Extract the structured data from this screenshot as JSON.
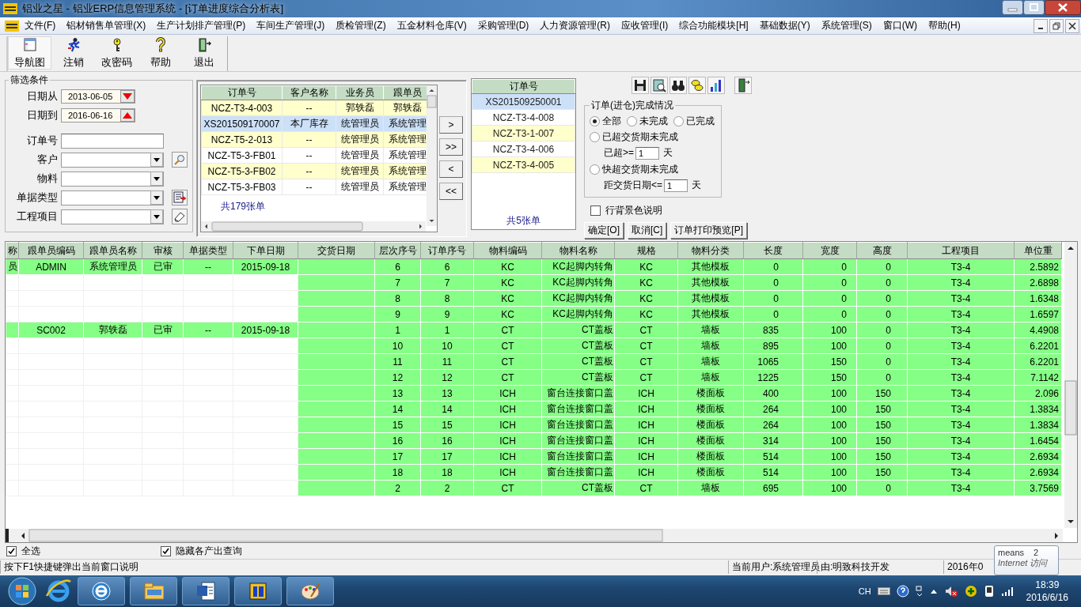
{
  "window": {
    "title": "铝业之星 - 铝业ERP信息管理系统 - [订单进度综合分析表]"
  },
  "menu": [
    "文件(F)",
    "铝材销售单管理(X)",
    "生产计划排产管理(P)",
    "车间生产管理(J)",
    "质检管理(Z)",
    "五金材料仓库(V)",
    "采购管理(D)",
    "人力资源管理(R)",
    "应收管理(I)",
    "综合功能模块[H]",
    "基础数据(Y)",
    "系统管理(S)",
    "窗口(W)",
    "帮助(H)"
  ],
  "toolbar": [
    {
      "label": "导航图",
      "selected": true
    },
    {
      "label": "注销",
      "selected": false
    },
    {
      "label": "改密码",
      "selected": false
    },
    {
      "label": "帮助",
      "selected": false
    },
    {
      "label": "退出",
      "selected": false
    }
  ],
  "filter": {
    "title": "筛选条件",
    "fields": [
      {
        "label": "日期从",
        "kind": "date",
        "value": "2013-06-05"
      },
      {
        "label": "日期到",
        "kind": "date",
        "value": "2016-06-16"
      },
      {
        "label": "订单号",
        "kind": "text"
      },
      {
        "label": "客户",
        "kind": "combo"
      },
      {
        "label": "物料",
        "kind": "combo"
      },
      {
        "label": "单据类型",
        "kind": "combo"
      },
      {
        "label": "工程项目",
        "kind": "combo"
      }
    ]
  },
  "orders": {
    "columns": [
      "订单号",
      "客户名称",
      "业务员",
      "跟单员"
    ],
    "rows": [
      {
        "cells": [
          "NCZ-T3-4-003",
          "--",
          "郭轶磊",
          "郭轶磊"
        ],
        "selected": false,
        "color": "#ffffcc"
      },
      {
        "cells": [
          "XS201509170007",
          "本厂库存",
          "统管理员",
          "系统管理"
        ],
        "selected": true
      },
      {
        "cells": [
          "NCZ-T5-2-013",
          "--",
          "统管理员",
          "系统管理"
        ],
        "selected": false,
        "color": "#ffffcc"
      },
      {
        "cells": [
          "NCZ-T5-3-FB01",
          "--",
          "统管理员",
          "系统管理"
        ],
        "selected": false,
        "color": "#ffffff"
      },
      {
        "cells": [
          "NCZ-T5-3-FB02",
          "--",
          "统管理员",
          "系统管理"
        ],
        "selected": false,
        "color": "#ffffcc"
      },
      {
        "cells": [
          "NCZ-T5-3-FB03",
          "--",
          "统管理员",
          "系统管理"
        ],
        "selected": false,
        "color": "#ffffff"
      }
    ],
    "count": "共179张单"
  },
  "transfer_buttons": [
    ">",
    ">>",
    "<",
    "<<"
  ],
  "picked": {
    "column": "订单号",
    "rows": [
      {
        "text": "XS201509250001",
        "selected": true
      },
      {
        "text": "NCZ-T3-4-008",
        "selected": false,
        "color": "#ffffff"
      },
      {
        "text": "NCZ-T3-1-007",
        "selected": false,
        "color": "#ffffcc"
      },
      {
        "text": "NCZ-T3-4-006",
        "selected": false,
        "color": "#ffffff"
      },
      {
        "text": "NCZ-T3-4-005",
        "selected": false,
        "color": "#ffffcc"
      }
    ],
    "count": "共5张单"
  },
  "completion": {
    "title": "订单(进仓)完成情况",
    "options": [
      {
        "label": "全部",
        "selected": true
      },
      {
        "label": "未完成",
        "selected": false
      },
      {
        "label": "已完成",
        "selected": false
      },
      {
        "label": "已超交货期未完成",
        "selected": false,
        "prefix": "已超>=",
        "value": "1",
        "unit": "天"
      },
      {
        "label": "快超交货期未完成",
        "selected": false,
        "prefix": "距交货日期<=",
        "value": "1",
        "unit": "天"
      }
    ]
  },
  "row_color_legend": {
    "label": "行背景色说明",
    "checked": false
  },
  "actions": [
    "确定[O]",
    "取消[C]",
    "订单打印预览[P]"
  ],
  "grid": {
    "columns": [
      "称",
      "跟单员编码",
      "跟单员名称",
      "审核",
      "单据类型",
      "下单日期",
      "交货日期",
      "层次序号",
      "订单序号",
      "物料编码",
      "物料名称",
      "规格",
      "物料分类",
      "长度",
      "宽度",
      "高度",
      "工程项目",
      "单位重"
    ],
    "rows": [
      {
        "kind": "group",
        "cells": [
          "员",
          "ADMIN",
          "系统管理员",
          "已审",
          "--",
          "2015-09-18",
          "",
          "6",
          "6",
          "KC",
          "KC起脚内转角",
          "KC",
          "其他模板",
          "0",
          "0",
          "0",
          "T3-4",
          "2.5892"
        ]
      },
      {
        "kind": "detail",
        "cells": [
          "",
          "",
          "",
          "",
          "",
          "",
          "",
          "7",
          "7",
          "KC",
          "KC起脚内转角",
          "KC",
          "其他模板",
          "0",
          "0",
          "0",
          "T3-4",
          "2.6898"
        ]
      },
      {
        "kind": "detail",
        "cells": [
          "",
          "",
          "",
          "",
          "",
          "",
          "",
          "8",
          "8",
          "KC",
          "KC起脚内转角",
          "KC",
          "其他模板",
          "0",
          "0",
          "0",
          "T3-4",
          "1.6348"
        ]
      },
      {
        "kind": "detail",
        "cells": [
          "",
          "",
          "",
          "",
          "",
          "",
          "",
          "9",
          "9",
          "KC",
          "KC起脚内转角",
          "KC",
          "其他模板",
          "0",
          "0",
          "0",
          "T3-4",
          "1.6597"
        ]
      },
      {
        "kind": "group",
        "cells": [
          "",
          "SC002",
          "郭轶磊",
          "已审",
          "--",
          "2015-09-18",
          "",
          "1",
          "1",
          "CT",
          "CT盖板",
          "CT",
          "墙板",
          "835",
          "100",
          "0",
          "T3-4",
          "4.4908"
        ]
      },
      {
        "kind": "detail",
        "cells": [
          "",
          "",
          "",
          "",
          "",
          "",
          "",
          "10",
          "10",
          "CT",
          "CT盖板",
          "CT",
          "墙板",
          "895",
          "100",
          "0",
          "T3-4",
          "6.2201"
        ]
      },
      {
        "kind": "detail",
        "cells": [
          "",
          "",
          "",
          "",
          "",
          "",
          "",
          "11",
          "11",
          "CT",
          "CT盖板",
          "CT",
          "墙板",
          "1065",
          "150",
          "0",
          "T3-4",
          "6.2201"
        ]
      },
      {
        "kind": "detail",
        "cells": [
          "",
          "",
          "",
          "",
          "",
          "",
          "",
          "12",
          "12",
          "CT",
          "CT盖板",
          "CT",
          "墙板",
          "1225",
          "150",
          "0",
          "T3-4",
          "7.1142"
        ]
      },
      {
        "kind": "detail",
        "cells": [
          "",
          "",
          "",
          "",
          "",
          "",
          "",
          "13",
          "13",
          "ICH",
          "窗台连接窗口盖",
          "ICH",
          "楼面板",
          "400",
          "100",
          "150",
          "T3-4",
          "2.096"
        ]
      },
      {
        "kind": "detail",
        "cells": [
          "",
          "",
          "",
          "",
          "",
          "",
          "",
          "14",
          "14",
          "ICH",
          "窗台连接窗口盖",
          "ICH",
          "楼面板",
          "264",
          "100",
          "150",
          "T3-4",
          "1.3834"
        ]
      },
      {
        "kind": "detail",
        "cells": [
          "",
          "",
          "",
          "",
          "",
          "",
          "",
          "15",
          "15",
          "ICH",
          "窗台连接窗口盖",
          "ICH",
          "楼面板",
          "264",
          "100",
          "150",
          "T3-4",
          "1.3834"
        ]
      },
      {
        "kind": "detail",
        "cells": [
          "",
          "",
          "",
          "",
          "",
          "",
          "",
          "16",
          "16",
          "ICH",
          "窗台连接窗口盖",
          "ICH",
          "楼面板",
          "314",
          "100",
          "150",
          "T3-4",
          "1.6454"
        ]
      },
      {
        "kind": "detail",
        "cells": [
          "",
          "",
          "",
          "",
          "",
          "",
          "",
          "17",
          "17",
          "ICH",
          "窗台连接窗口盖",
          "ICH",
          "楼面板",
          "514",
          "100",
          "150",
          "T3-4",
          "2.6934"
        ]
      },
      {
        "kind": "detail",
        "cells": [
          "",
          "",
          "",
          "",
          "",
          "",
          "",
          "18",
          "18",
          "ICH",
          "窗台连接窗口盖",
          "ICH",
          "楼面板",
          "514",
          "100",
          "150",
          "T3-4",
          "2.6934"
        ]
      },
      {
        "kind": "detail",
        "cells": [
          "",
          "",
          "",
          "",
          "",
          "",
          "",
          "2",
          "2",
          "CT",
          "CT盖板",
          "CT",
          "墙板",
          "695",
          "100",
          "0",
          "T3-4",
          "3.7569"
        ]
      }
    ]
  },
  "options_bar": [
    {
      "label": "全选",
      "checked": true
    },
    {
      "label": "隐藏各产出查询",
      "checked": true
    }
  ],
  "status_bar": [
    "按下F1快捷键弹出当前窗口说明",
    "当前用户:系统管理员",
    "由:明致科技开发",
    "2016年0"
  ],
  "tooltip": {
    "title": "means",
    "count": "2",
    "subtitle": "Internet 访问"
  },
  "taskbar": {
    "language": "CH",
    "time": "18:39",
    "date": "2016/6/16"
  }
}
